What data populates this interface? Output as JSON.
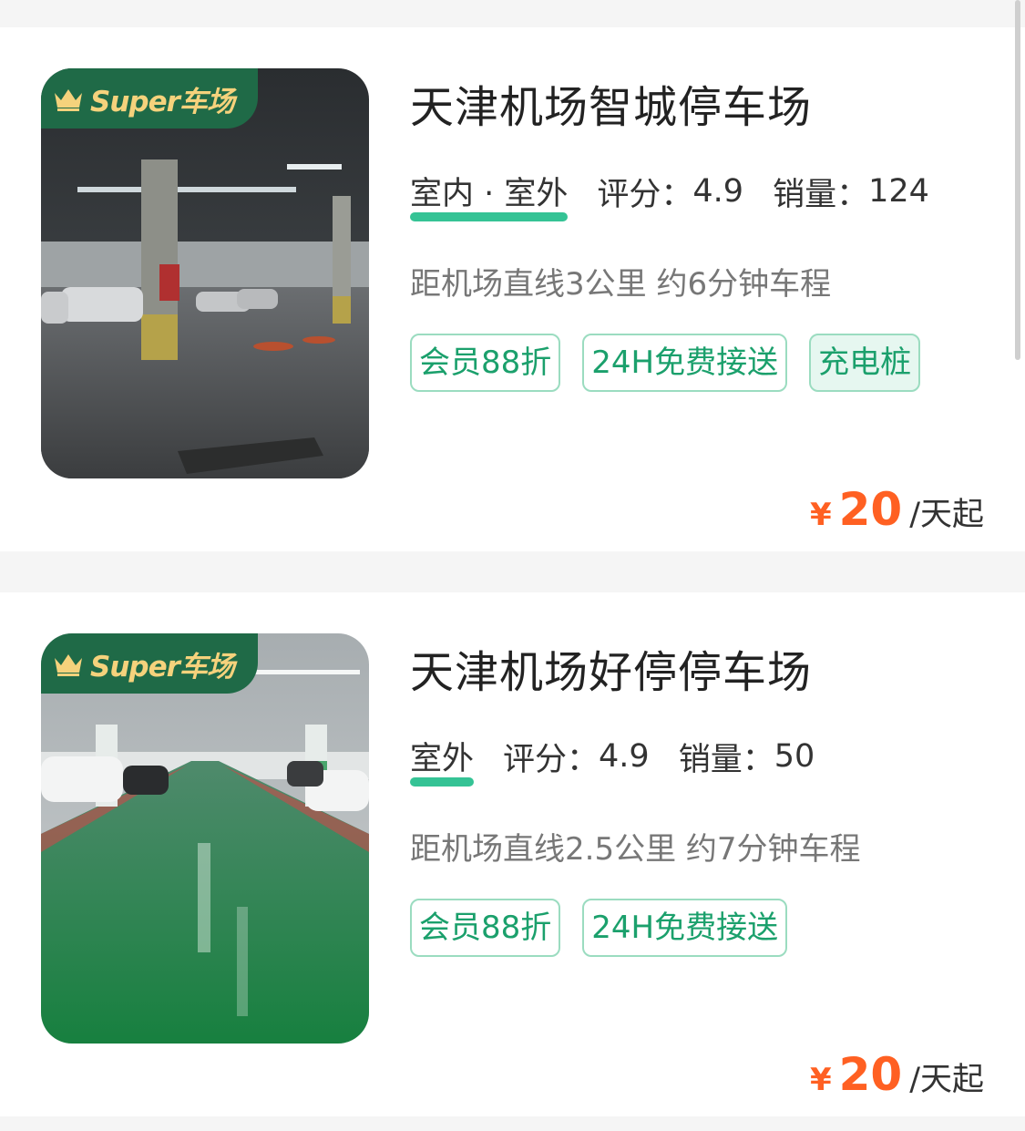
{
  "listings": [
    {
      "badge": "Super车场",
      "name": "天津机场智城停车场",
      "environment": "室内 · 室外",
      "rating_label": "评分：",
      "rating": "4.9",
      "sales_label": "销量：",
      "sales": "124",
      "distance": "距机场直线3公里 约6分钟车程",
      "tags": [
        "会员88折",
        "24H免费接送"
      ],
      "tags_filled": [
        "充电桩"
      ],
      "price_currency": "¥",
      "price": "20",
      "price_unit": "/天起"
    },
    {
      "badge": "Super车场",
      "name": "天津机场好停停车场",
      "environment": "室外",
      "rating_label": "评分：",
      "rating": "4.9",
      "sales_label": "销量：",
      "sales": "50",
      "distance": "距机场直线2.5公里 约7分钟车程",
      "tags": [
        "会员88折",
        "24H免费接送"
      ],
      "price_currency": "¥",
      "price": "20",
      "price_unit": "/天起"
    }
  ],
  "colors": {
    "accent": "#12b883",
    "tag_text": "#1ba06c",
    "price": "#ff6022",
    "badge_bg": "#1f6a47",
    "badge_text": "#f5d27c"
  },
  "icons": {
    "badge": "crown-icon"
  }
}
